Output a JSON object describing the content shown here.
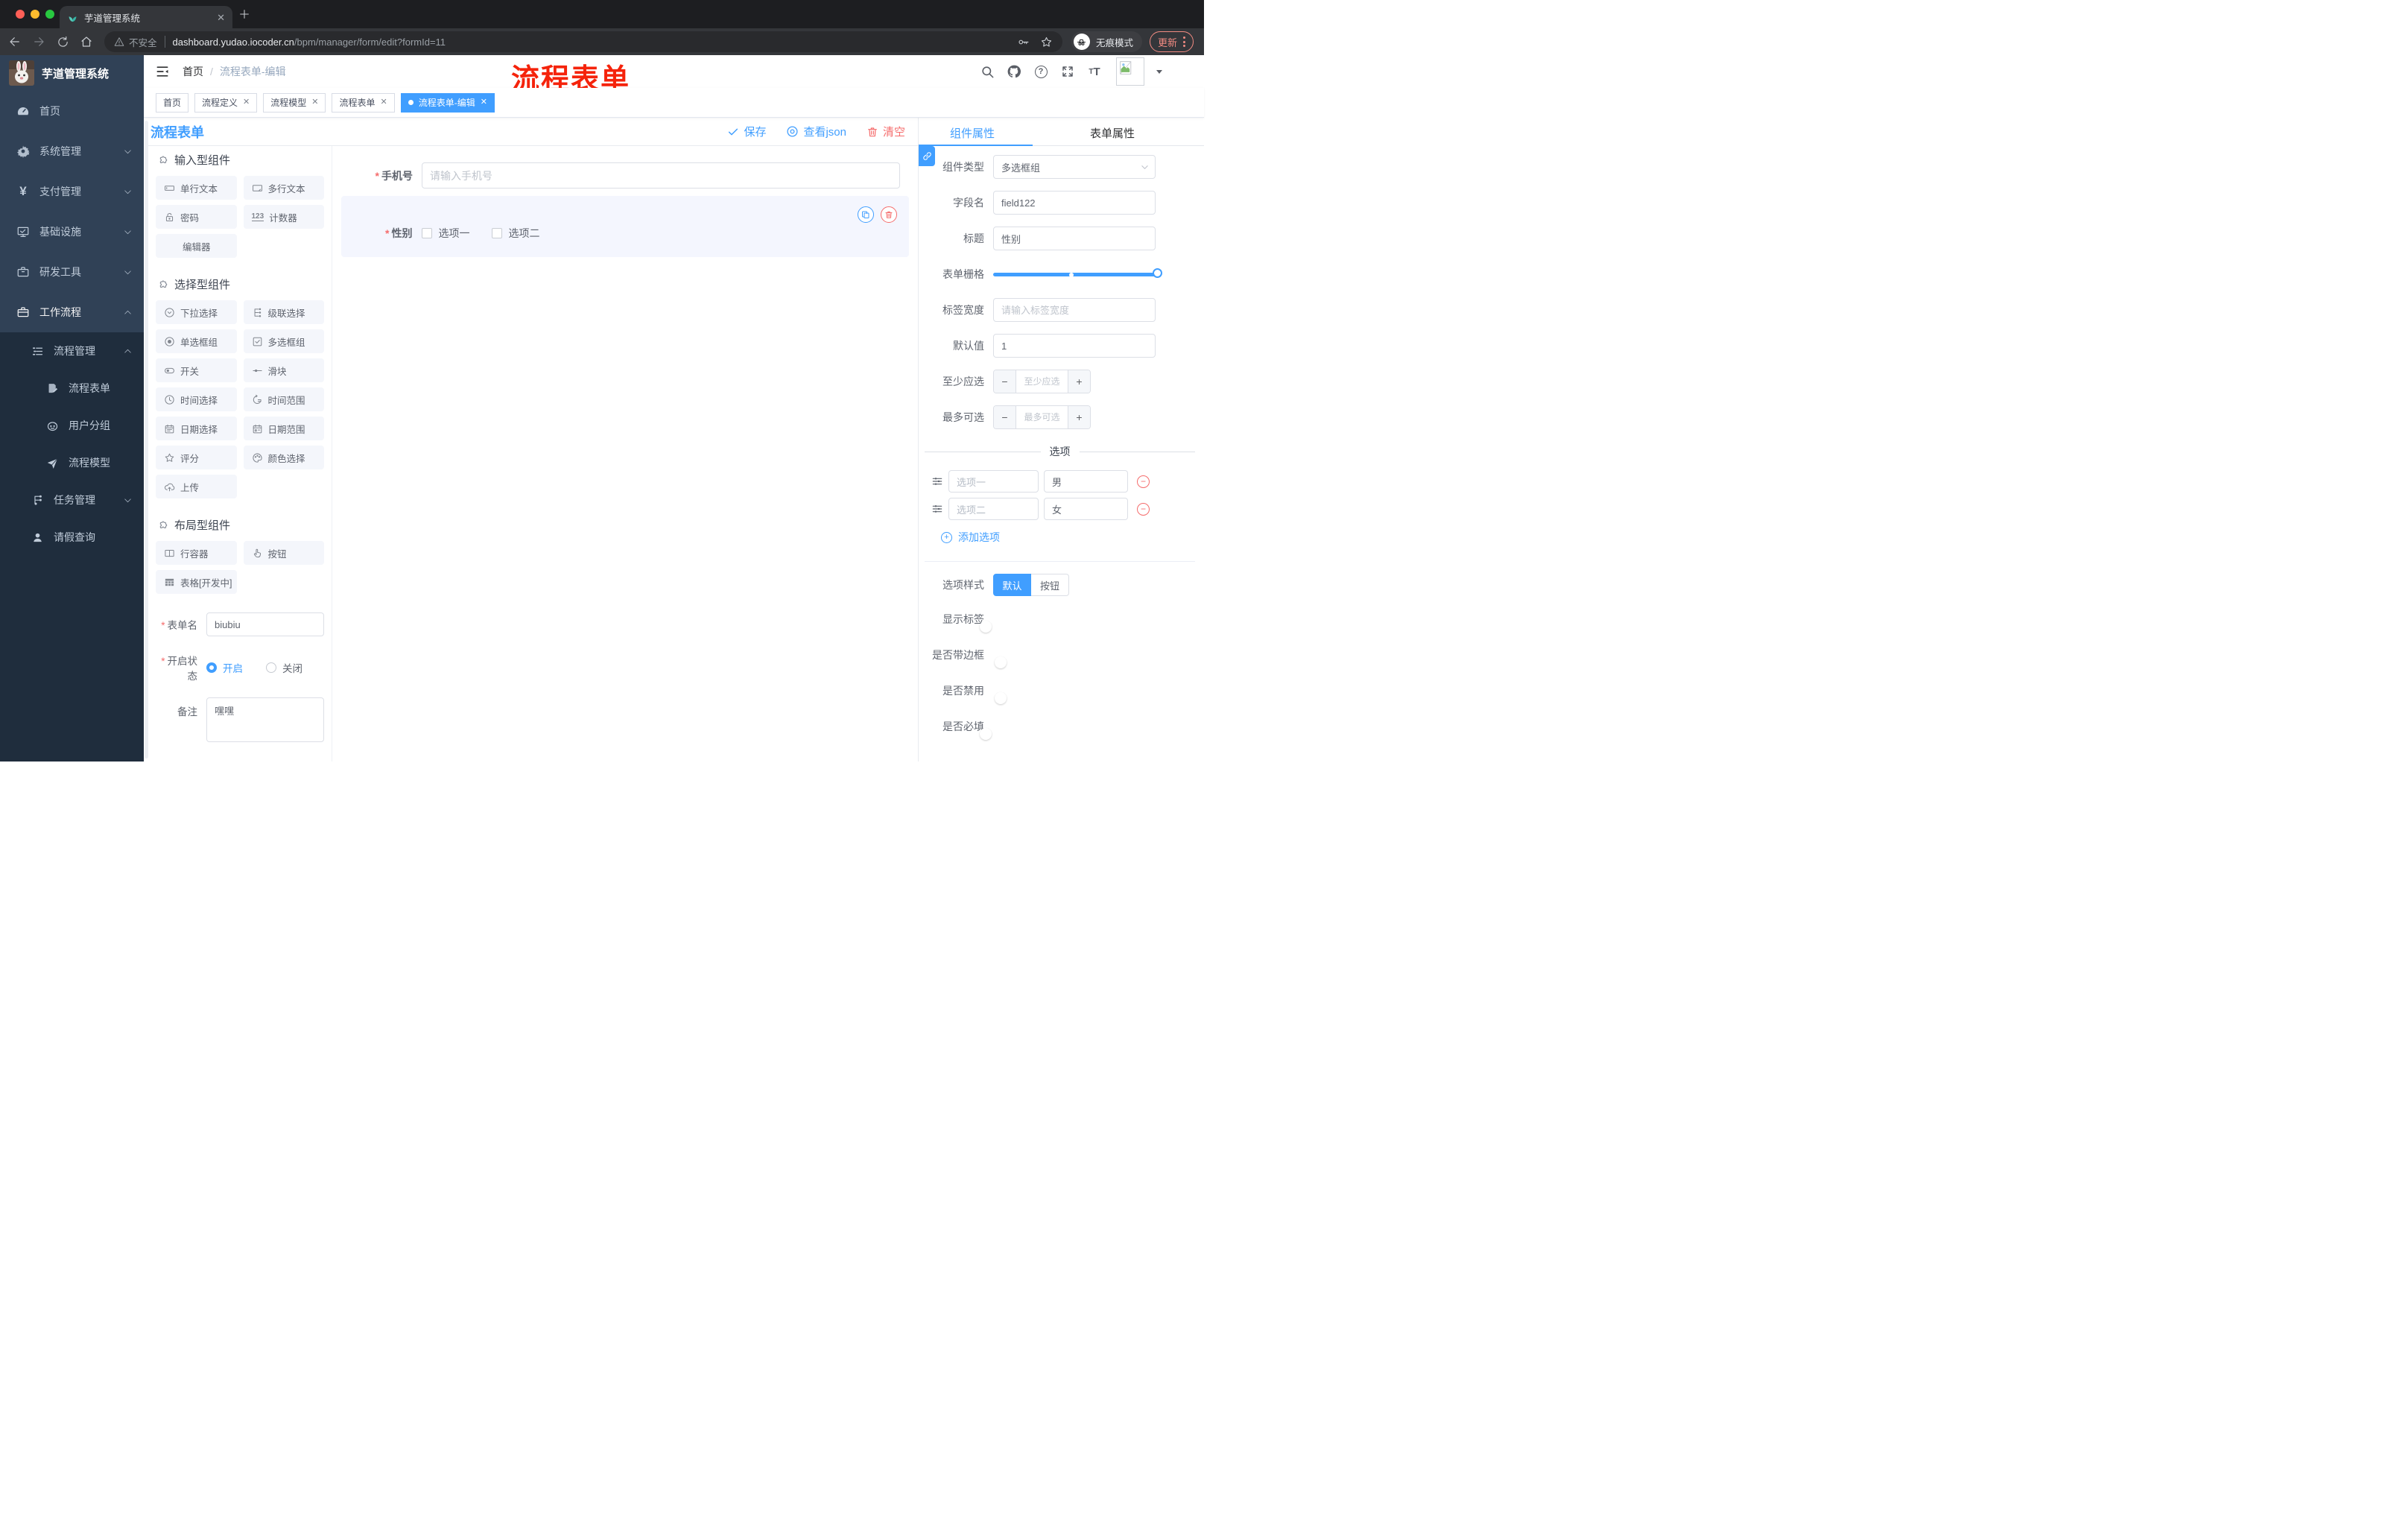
{
  "colors": {
    "accent": "#409eff",
    "danger": "#f56c6c",
    "annotation_red": "#f5230b",
    "sidebar_bg": "#304156",
    "sidebar_submenu_bg": "#1f2d3d",
    "palette_item_bg": "#f4f6fb",
    "selected_block_bg": "#f4f6fe",
    "chrome_bg": "#34363a",
    "tag_active_bg": "#409eff"
  },
  "browser": {
    "tab_title": "芋道管理系统",
    "address": {
      "warning_label": "不安全",
      "domain": "dashboard.yudao.iocoder.cn",
      "path": "/bpm/manager/form/edit?formId=11"
    },
    "incognito_label": "无痕模式",
    "update_label": "更新"
  },
  "sidebar": {
    "app_title": "芋道管理系统",
    "items": [
      {
        "label": "首页",
        "icon": "dashboard-icon"
      },
      {
        "label": "系统管理",
        "icon": "gear-icon",
        "chevron": "down"
      },
      {
        "label": "支付管理",
        "icon": "yen-icon",
        "chevron": "down"
      },
      {
        "label": "基础设施",
        "icon": "monitor-icon",
        "chevron": "down"
      },
      {
        "label": "研发工具",
        "icon": "briefcase-icon",
        "chevron": "down"
      },
      {
        "label": "工作流程",
        "icon": "suitcase-icon",
        "chevron": "up"
      }
    ],
    "submenu": [
      {
        "label": "流程管理",
        "icon": "list-icon",
        "chevron": "up"
      },
      {
        "label": "流程表单",
        "icon": "document-edit-icon"
      },
      {
        "label": "用户分组",
        "icon": "face-icon"
      },
      {
        "label": "流程模型",
        "icon": "paper-plane-icon"
      },
      {
        "label": "任务管理",
        "icon": "tree-icon",
        "chevron": "down"
      },
      {
        "label": "请假查询",
        "icon": "user-icon"
      }
    ]
  },
  "navbar": {
    "breadcrumb_home": "首页",
    "breadcrumb_sep": "/",
    "breadcrumb_current": "流程表单-编辑",
    "annotation": "流程表单"
  },
  "tags": [
    {
      "label": "首页"
    },
    {
      "label": "流程定义"
    },
    {
      "label": "流程模型"
    },
    {
      "label": "流程表单"
    },
    {
      "label": "流程表单-编辑"
    }
  ],
  "editor": {
    "title": "流程表单",
    "actions": {
      "save": "保存",
      "view_json": "查看json",
      "clear": "清空"
    },
    "palette": {
      "sections": [
        {
          "title": "输入型组件",
          "items": [
            {
              "label": "单行文本",
              "icon": "input-icon"
            },
            {
              "label": "多行文本",
              "icon": "textarea-icon"
            },
            {
              "label": "密码",
              "icon": "lock-icon"
            },
            {
              "label": "计数器",
              "icon": "counter-icon"
            },
            {
              "label": "编辑器",
              "icon": "none"
            }
          ]
        },
        {
          "title": "选择型组件",
          "items": [
            {
              "label": "下拉选择",
              "icon": "select-icon"
            },
            {
              "label": "级联选择",
              "icon": "cascader-icon"
            },
            {
              "label": "单选框组",
              "icon": "radio-icon"
            },
            {
              "label": "多选框组",
              "icon": "checkbox-icon"
            },
            {
              "label": "开关",
              "icon": "switch-icon"
            },
            {
              "label": "滑块",
              "icon": "slider-icon"
            },
            {
              "label": "时间选择",
              "icon": "clock-icon"
            },
            {
              "label": "时间范围",
              "icon": "time-range-icon"
            },
            {
              "label": "日期选择",
              "icon": "calendar-icon"
            },
            {
              "label": "日期范围",
              "icon": "calendar-range-icon"
            },
            {
              "label": "评分",
              "icon": "star-icon"
            },
            {
              "label": "颜色选择",
              "icon": "palette-icon"
            },
            {
              "label": "上传",
              "icon": "upload-icon"
            }
          ]
        },
        {
          "title": "布局型组件",
          "items": [
            {
              "label": "行容器",
              "icon": "row-container-icon"
            },
            {
              "label": "按钮",
              "icon": "button-hand-icon"
            },
            {
              "label": "表格[开发中]",
              "icon": "table-icon"
            }
          ]
        }
      ]
    },
    "meta": {
      "name_label": "表单名",
      "name_value": "biubiu",
      "status_label": "开启状态",
      "status_on": "开启",
      "status_off": "关闭",
      "remark_label": "备注",
      "remark_value": "嘿嘿"
    },
    "canvas": {
      "phone_label": "手机号",
      "phone_placeholder": "请输入手机号",
      "gender_label": "性别",
      "gender_option1": "选项一",
      "gender_option2": "选项二"
    }
  },
  "inspector": {
    "tab_component": "组件属性",
    "tab_form": "表单属性",
    "component_type_label": "组件类型",
    "component_type_value": "多选框组",
    "field_name_label": "字段名",
    "field_name_value": "field122",
    "title_label": "标题",
    "title_value": "性别",
    "grid_label": "表单栅格",
    "label_width_label": "标签宽度",
    "label_width_placeholder": "请输入标签宽度",
    "default_label": "默认值",
    "default_value": "1",
    "min_label": "至少应选",
    "min_placeholder": "至少应选",
    "max_label": "最多可选",
    "max_placeholder": "最多可选",
    "options_title": "选项",
    "options": [
      {
        "label": "选项一",
        "value": "男"
      },
      {
        "label": "选项二",
        "value": "女"
      }
    ],
    "add_option_label": "添加选项",
    "style_label": "选项样式",
    "style_default": "默认",
    "style_button": "按钮",
    "switch_show_label": "显示标签",
    "switch_border": "是否带边框",
    "switch_disabled": "是否禁用",
    "switch_required": "是否必填"
  }
}
